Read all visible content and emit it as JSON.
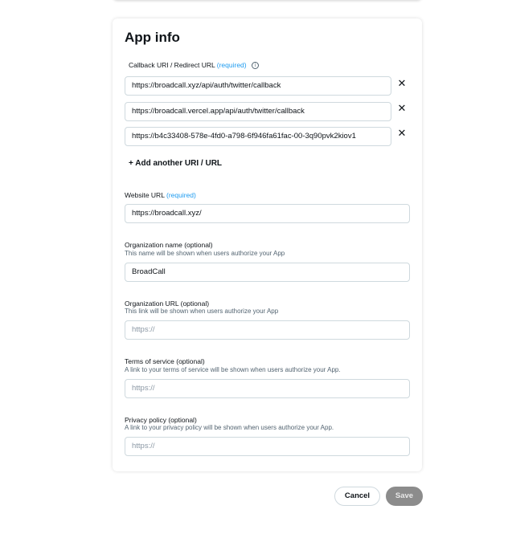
{
  "app_info": {
    "title": "App info",
    "callback": {
      "label": "Callback URI / Redirect URL",
      "required": "(required)",
      "info_icon": "i",
      "urls": [
        "https://broadcall.xyz/api/auth/twitter/callback",
        "https://broadcall.vercel.app/api/auth/twitter/callback",
        "https://b4c33408-578e-4fd0-a798-6f946fa61fac-00-3q90pvk2kiov1"
      ],
      "remove_glyph": "✕",
      "add_label": "+ Add another URI / URL"
    },
    "website": {
      "label": "Website URL",
      "required": "(required)",
      "value": "https://broadcall.xyz/"
    },
    "org_name": {
      "label": "Organization name",
      "optional": "(optional)",
      "helper": "This name will be shown when users authorize your App",
      "value": "BroadCall"
    },
    "org_url": {
      "label": "Organization URL",
      "optional": "(optional)",
      "helper": "This link will be shown when users authorize your App",
      "placeholder": "https://"
    },
    "terms": {
      "label": "Terms of service",
      "optional": "(optional)",
      "helper": "A link to your terms of service will be shown when users authorize your App.",
      "placeholder": "https://"
    },
    "privacy": {
      "label": "Privacy policy",
      "optional": "(optional)",
      "helper": "A link to your privacy policy will be shown when users authorize your App.",
      "placeholder": "https://"
    }
  },
  "actions": {
    "cancel": "Cancel",
    "save": "Save"
  },
  "colors": {
    "accent": "#1d9bf0",
    "text": "#0f1419",
    "muted": "#536471",
    "border": "#cfd9de",
    "save_disabled": "#8c8c8c"
  }
}
